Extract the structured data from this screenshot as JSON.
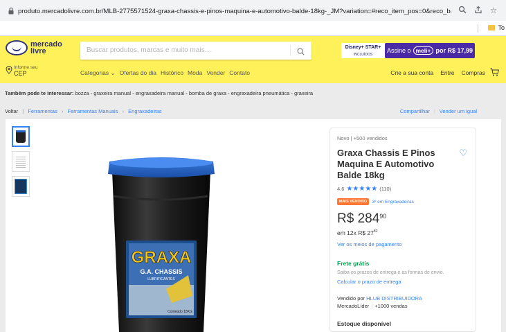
{
  "browser": {
    "url": "produto.mercadolivre.com.br/MLB-2775571524-graxa-chassis-e-pinos-maquina-e-automotivo-balde-18kg-_JM?variation=#reco_item_pos=0&reco_backend...",
    "bookmark_label": "To"
  },
  "header": {
    "logo_line1": "mercado",
    "logo_line2": "livre",
    "search_placeholder": "Buscar produtos, marcas e muito mais…",
    "promo_disney": "Disney+ STAR+",
    "promo_disney_sub": "INCLUÍDOS",
    "assine": "Assine o",
    "meli": "meli+",
    "assine_price": "por R$ 17,99",
    "cep_small": "Informe seu",
    "cep_big": "CEP",
    "nav": [
      "Categorias ⌄",
      "Ofertas do dia",
      "Histórico",
      "Moda",
      "Vender",
      "Contato"
    ],
    "right_nav": [
      "Crie a sua conta",
      "Entre",
      "Compras"
    ]
  },
  "interest": {
    "label": "Também pode te interessar:",
    "items": "bozza - graxeira manual - engraxadeira manual - bomba de graxa - engraxadeira pneumática - graxeira"
  },
  "breadcrumb": {
    "back": "Voltar",
    "items": [
      "Ferramentas",
      "Ferramentas Manuais",
      "Engraxadeiras"
    ]
  },
  "share": {
    "share_label": "Compartilhar",
    "sell_label": "Vender um igual"
  },
  "product": {
    "condition": "Novo  |  +500 vendidos",
    "title": "Graxa Chassis E Pinos Maquina E Automotivo Balde 18kg",
    "rating": "4.6",
    "stars": "★★★★★",
    "reviews": "(110)",
    "badge": "MAIS VENDIDO",
    "badge_rank": "3º em Engraxadeiras",
    "price_main": "R$ 284",
    "price_cents": "90",
    "installments": "em 12x R$ 27",
    "installments_cents": "82",
    "payment_link": "Ver os meios de pagamento",
    "shipping_title": "Frete grátis",
    "shipping_desc": "Saiba os prazos de entrega e as formas de envio.",
    "shipping_link": "Calcular o prazo de entrega",
    "seller_prefix": "Vendido por",
    "seller_name": "HLUB DISTRIBUIDORA",
    "seller_level": "MercadoLíder",
    "seller_sales": "+1000 vendas",
    "stock": "Estoque disponível",
    "image_brand": "GRAXA",
    "image_sub": "G.A. CHASSIS",
    "image_sub2": "LUBRIFICANTES",
    "image_weight": "Conteúdo 18KG"
  },
  "colors": {
    "brand_yellow": "#fff159",
    "link_blue": "#3483fa",
    "green": "#00a650",
    "meli_purple": "#4b2aa6",
    "badge_orange": "#ff7733"
  }
}
